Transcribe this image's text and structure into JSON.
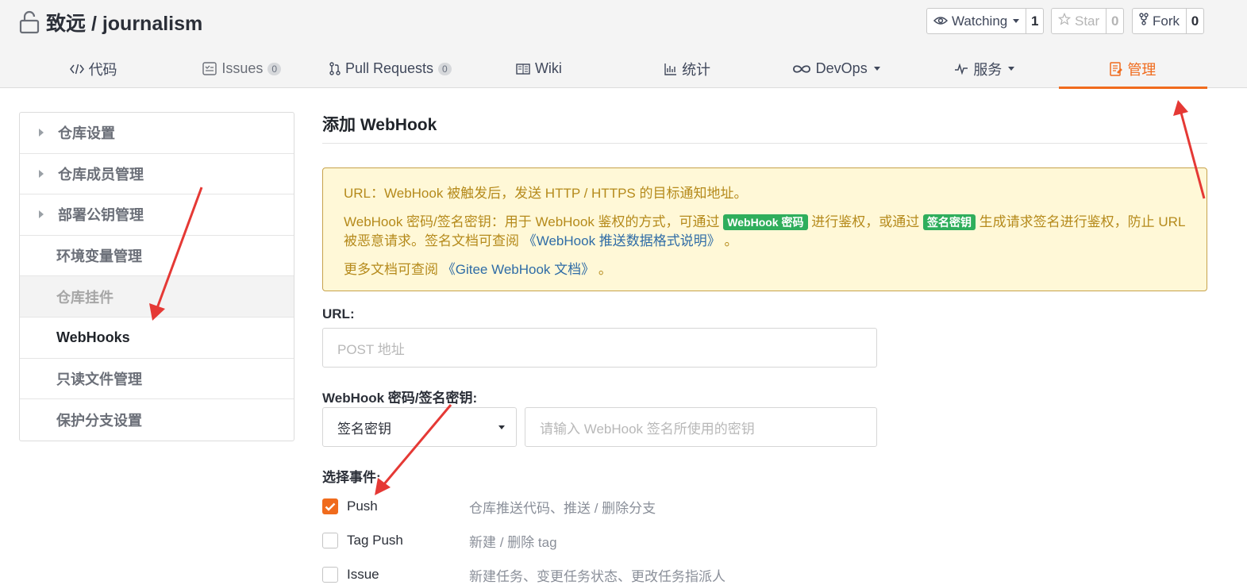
{
  "repo": {
    "title": "致远 / journalism"
  },
  "actions": [
    {
      "label": "Watching",
      "count": "1",
      "dropdown": true
    },
    {
      "label": "Star",
      "count": "0",
      "disabled": true
    },
    {
      "label": "Fork",
      "count": "0"
    }
  ],
  "tabs": [
    {
      "label": "代码",
      "icon": "code-icon"
    },
    {
      "label": "Issues",
      "icon": "issues-icon",
      "badge": "0"
    },
    {
      "label": "Pull Requests",
      "icon": "pull-request-icon",
      "badge": "0"
    },
    {
      "label": "Wiki",
      "icon": "wiki-icon"
    },
    {
      "label": "统计",
      "icon": "chart-icon"
    },
    {
      "label": "DevOps",
      "icon": "infinity-icon",
      "dropdown": true
    },
    {
      "label": "服务",
      "icon": "pulse-icon",
      "dropdown": true
    },
    {
      "label": "管理",
      "icon": "manage-icon",
      "active": true
    }
  ],
  "sidebar": {
    "items": [
      {
        "label": "仓库设置",
        "expandable": true
      },
      {
        "label": "仓库成员管理",
        "expandable": true
      },
      {
        "label": "部署公钥管理",
        "expandable": true
      },
      {
        "label": "环境变量管理"
      },
      {
        "label": "仓库挂件",
        "hover": true
      },
      {
        "label": "WebHooks",
        "active": true
      },
      {
        "label": "只读文件管理"
      },
      {
        "label": "保护分支设置"
      }
    ]
  },
  "main": {
    "title": "添加 WebHook",
    "notice": {
      "line1": "URL：WebHook 被触发后，发送 HTTP / HTTPS 的目标通知地址。",
      "line2_a": "WebHook 密码/签名密钥：用于 WebHook 鉴权的方式，可通过 ",
      "tag_password": "WebHook 密码",
      "line2_b": " 进行鉴权，或通过 ",
      "tag_sign": "签名密钥",
      "line2_c": " 生成请求签名进行鉴权，防止 URL 被恶意请求。签名文档可查阅 ",
      "link_format": "《WebHook 推送数据格式说明》",
      "line2_d": " 。",
      "line3_a": "更多文档可查阅 ",
      "link_docs": "《Gitee WebHook 文档》",
      "line3_b": " 。"
    },
    "url_label": "URL:",
    "url_placeholder": "POST 地址",
    "secret_label": "WebHook 密码/签名密钥:",
    "secret_type_selected": "签名密钥",
    "secret_placeholder": "请输入 WebHook 签名所使用的密钥",
    "events_label": "选择事件:",
    "events": [
      {
        "name": "Push",
        "desc": "仓库推送代码、推送 / 删除分支",
        "checked": true
      },
      {
        "name": "Tag Push",
        "desc": "新建 / 删除 tag",
        "checked": false
      },
      {
        "name": "Issue",
        "desc": "新建任务、变更任务状态、更改任务指派人",
        "checked": false
      }
    ]
  },
  "colors": {
    "accent": "#f06b1d",
    "annotation_arrow": "#e53935",
    "notice_bg": "#fff8d7",
    "tag_green": "#2fae5c"
  }
}
